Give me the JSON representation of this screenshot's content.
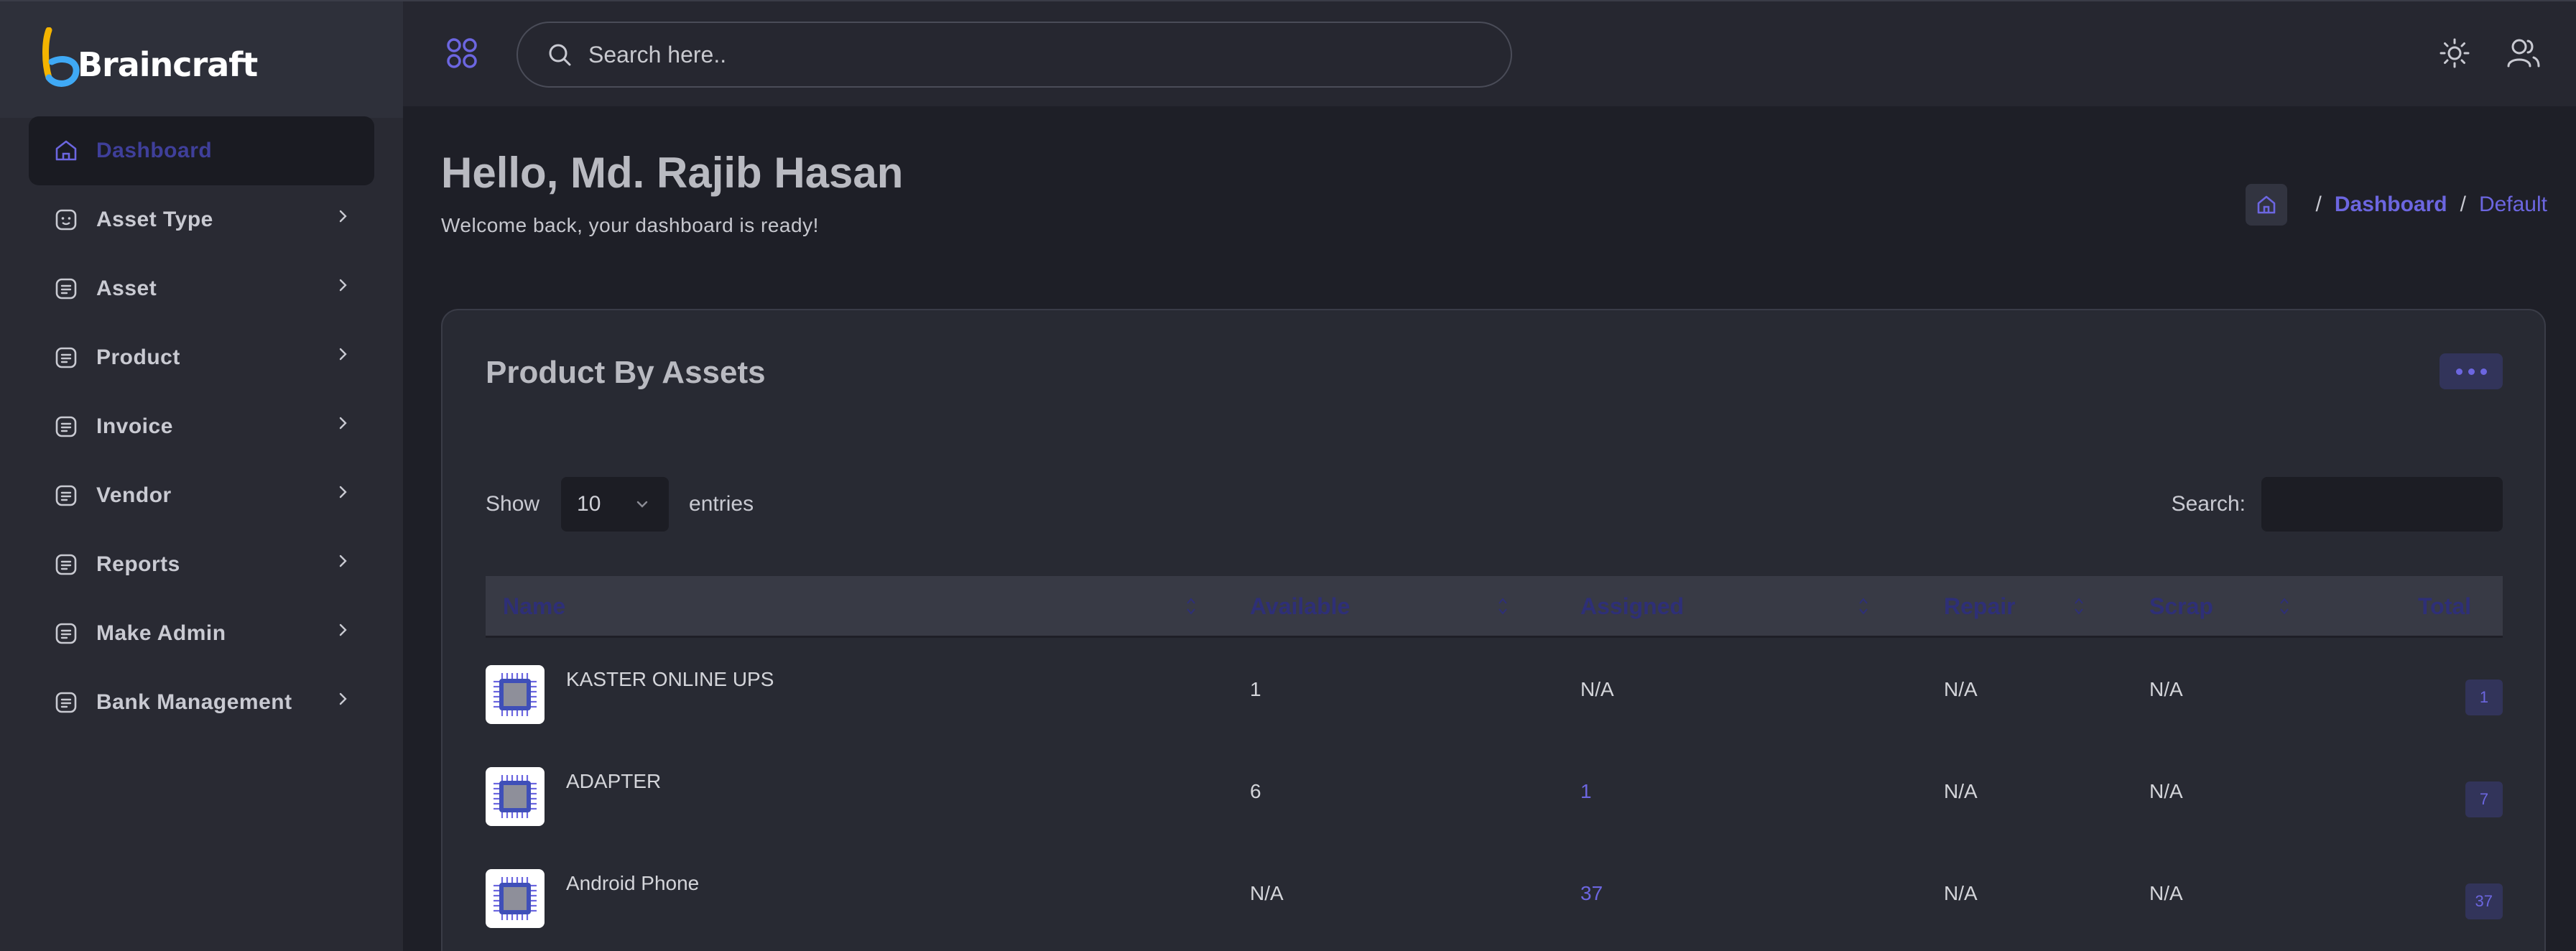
{
  "brand": {
    "name": "Braincraft"
  },
  "sidebar": {
    "items": [
      {
        "label": "Dashboard",
        "icon": "home-icon",
        "active": true
      },
      {
        "label": "Asset Type",
        "icon": "asset-type-icon"
      },
      {
        "label": "Asset",
        "icon": "document-icon"
      },
      {
        "label": "Product",
        "icon": "document-icon"
      },
      {
        "label": "Invoice",
        "icon": "document-icon"
      },
      {
        "label": "Vendor",
        "icon": "document-icon"
      },
      {
        "label": "Reports",
        "icon": "document-icon"
      },
      {
        "label": "Make Admin",
        "icon": "document-icon"
      },
      {
        "label": "Bank Management",
        "icon": "document-icon"
      }
    ]
  },
  "header": {
    "search_placeholder": "Search here.."
  },
  "greeting": {
    "title": "Hello, Md. Rajib Hasan",
    "subtitle": "Welcome back, your dashboard is ready!"
  },
  "breadcrumb": {
    "sep": "/",
    "link": "Dashboard",
    "current": "Default"
  },
  "card": {
    "title": "Product By Assets",
    "show_label": "Show",
    "entries_value": "10",
    "entries_label": "entries",
    "search_label": "Search:",
    "columns": [
      "Name",
      "Available",
      "Assigned",
      "Repair",
      "Scrap",
      "Total"
    ],
    "rows": [
      {
        "name": "KASTER ONLINE UPS",
        "available": "1",
        "assigned": "N/A",
        "repair": "N/A",
        "scrap": "N/A",
        "total": "1"
      },
      {
        "name": "ADAPTER",
        "available": "6",
        "assigned": "1",
        "repair": "N/A",
        "scrap": "N/A",
        "total": "7"
      },
      {
        "name": "Android Phone",
        "available": "N/A",
        "assigned": "37",
        "repair": "N/A",
        "scrap": "N/A",
        "total": "37"
      }
    ]
  },
  "colors": {
    "accent": "#6c66e0",
    "sidebar_bg": "#292a33",
    "page_bg": "#1e1f27",
    "card_bg": "#282a33",
    "header_text_dark": "#2e2f77"
  }
}
